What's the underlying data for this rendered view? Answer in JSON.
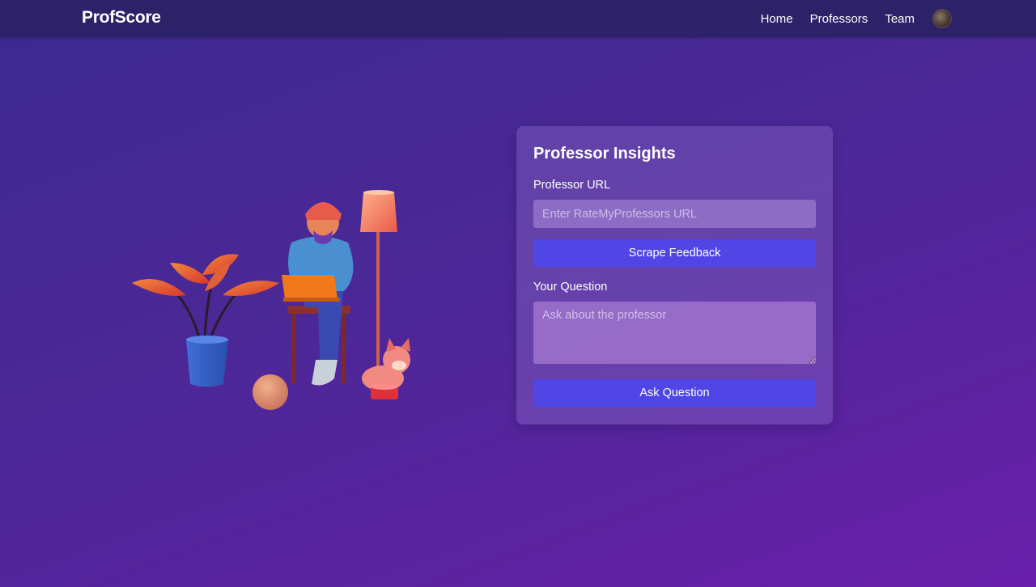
{
  "nav": {
    "brand": "ProfScore",
    "links": [
      "Home",
      "Professors",
      "Team"
    ]
  },
  "card": {
    "title": "Professor Insights",
    "url_label": "Professor URL",
    "url_placeholder": "Enter RateMyProfessors URL",
    "url_value": "",
    "scrape_button": "Scrape Feedback",
    "question_label": "Your Question",
    "question_placeholder": "Ask about the professor",
    "question_value": "",
    "ask_button": "Ask Question"
  },
  "illustration": {
    "subject": "person-with-laptop-plant-lamp-dog-illustration"
  },
  "colors": {
    "navbar": "#2d2168",
    "button": "#4f46e5",
    "background_start": "#3b2a8f",
    "background_end": "#6a1fad"
  }
}
